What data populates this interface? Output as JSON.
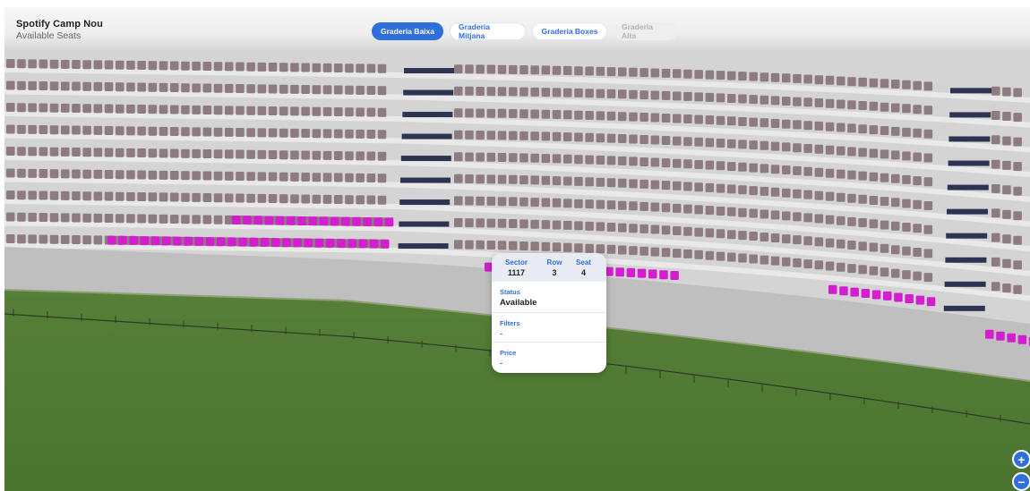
{
  "header": {
    "venue_name": "Spotify Camp Nou",
    "subtitle": "Available Seats"
  },
  "tabs": [
    {
      "label": "Graderia Baixa",
      "state": "active"
    },
    {
      "label": "Graderia Mitjana",
      "state": "normal"
    },
    {
      "label": "Graderia Boxes",
      "state": "normal"
    },
    {
      "label": "Graderia Alta",
      "state": "disabled"
    }
  ],
  "seat_info": {
    "sector_label": "Sector",
    "sector_value": "1117",
    "row_label": "Row",
    "row_value": "3",
    "seat_label": "Seat",
    "seat_value": "4",
    "status_label": "Status",
    "status_value": "Available",
    "filters_label": "Filters",
    "filters_value": "-",
    "price_label": "Price",
    "price_value": "-"
  },
  "zoom": {
    "in_symbol": "+",
    "out_symbol": "−"
  },
  "colors": {
    "accent": "#2f6fdc",
    "available_seat": "#d21ecf",
    "unavailable_seat": "#8e7b80",
    "pitch": "#4f7a2f"
  },
  "icons": {
    "zoom_in": "plus-icon",
    "zoom_out": "minus-icon"
  }
}
